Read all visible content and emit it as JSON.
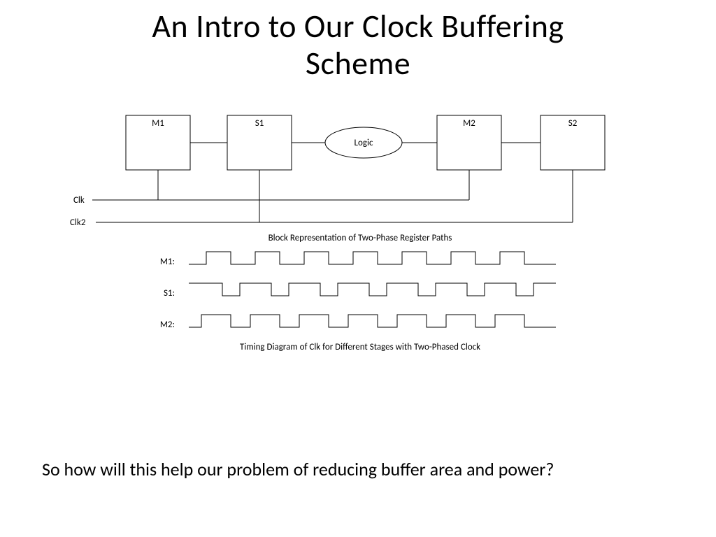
{
  "title_line1": "An Intro to Our Clock Buffering",
  "title_line2": "Scheme",
  "blocks": {
    "m1": "M1",
    "s1": "S1",
    "logic": "Logic",
    "m2": "M2",
    "s2": "S2"
  },
  "clk_labels": {
    "clk": "Clk",
    "clk2": "Clk2"
  },
  "caption1": "Block Representation of Two-Phase Register Paths",
  "waveforms": {
    "m1": "M1:",
    "s1": "S1:",
    "m2": "M2:"
  },
  "caption2": "Timing Diagram of Clk for Different Stages with Two-Phased Clock",
  "footer": "So how will this help our problem of reducing buffer area and power?"
}
